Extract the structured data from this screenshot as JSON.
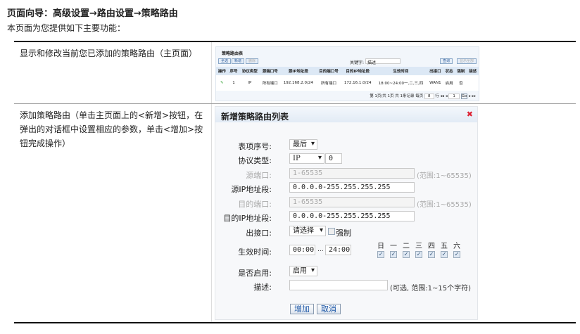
{
  "page": {
    "title": "页面向导：高级设置→路由设置→策略路由",
    "subtitle": "本页面为您提供如下主要功能："
  },
  "rows": [
    {
      "desc": "显示和修改当前您已添加的策略路由（主页面）"
    },
    {
      "desc": "添加策略路由（单击主页面上的<新增>按钮，在弹出的对话框中设置相应的参数，单击<增加>按钮完成操作）"
    }
  ],
  "mini_list": {
    "title": "策略路由表",
    "buttons": [
      "全选",
      "新增",
      "删除"
    ],
    "keyword_label": "关键字:",
    "keyword_value": "描述",
    "search": "查询",
    "show_all": "显示全部",
    "columns": [
      "操作",
      "序号",
      "协议类型",
      "源端口号",
      "源IP地址段",
      "目的端口号",
      "目的IP地址段",
      "生效时间",
      "出接口",
      "状态",
      "强制",
      "描述"
    ],
    "row": [
      "",
      "1",
      "IP",
      "所有端口",
      "192.168.2.0/24",
      "所有端口",
      "172.16.1.0/24",
      "18:00~24:00一,二,三,四",
      "WAN1",
      "启用",
      "否",
      ""
    ],
    "footer": "第 1页/共 1页 共 1条记录 每页",
    "per_page": "8",
    "footer2": "行",
    "page": "1",
    "go": "Go"
  },
  "dialog": {
    "title": "新增策略路由列表",
    "entry_label": "表项序号:",
    "entry_value": "最后",
    "proto_label": "协议类型:",
    "proto_value": "IP",
    "proto_num": "0",
    "src_port_label": "源端口:",
    "src_port_ph": "1-65535",
    "range1": "(范围:1~65535)",
    "src_ip_label": "源IP地址段:",
    "src_ip": "0.0.0.0-255.255.255.255",
    "dst_port_label": "目的端口:",
    "dst_port_ph": "1-65535",
    "range2": "(范围:1~65535)",
    "dst_ip_label": "目的IP地址段:",
    "dst_ip": "0.0.0.0-255.255.255.255",
    "iface_label": "出接口:",
    "iface_value": "请选择",
    "force": "强制",
    "time_label": "生效时间:",
    "start": "00:00",
    "sep": "...",
    "end": "24:00",
    "days": [
      "日",
      "一",
      "二",
      "三",
      "四",
      "五",
      "六"
    ],
    "enable_label": "是否启用:",
    "enable_value": "启用",
    "desc_label": "描述:",
    "desc_hint": "(可选, 范围:1~15个字符)",
    "add": "增加",
    "cancel": "取消"
  }
}
